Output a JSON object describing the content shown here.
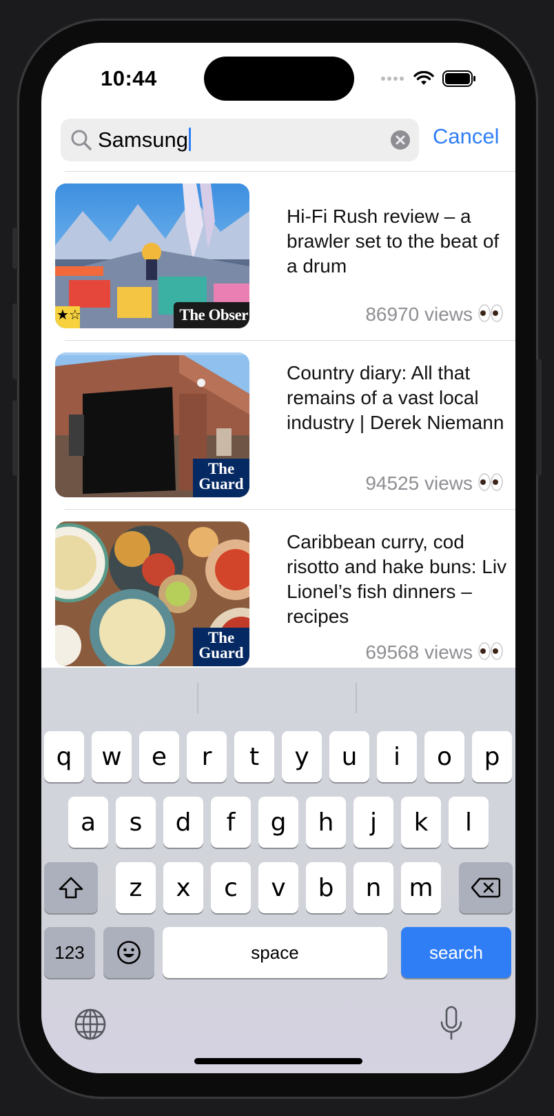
{
  "status": {
    "time": "10:44"
  },
  "search": {
    "query": "Samsung",
    "cancel_label": "Cancel"
  },
  "results": [
    {
      "title": "Hi-Fi Rush review – a brawler set to the beat of a drum",
      "views": "86970 views",
      "source": "The Observer",
      "source_short": "The Obser",
      "rating": "★☆"
    },
    {
      "title": "Country diary: All that remains of a vast local industry | Derek Niemann",
      "views": "94525 views",
      "source": "The Guardian",
      "source_short": "The Guard"
    },
    {
      "title": "Caribbean curry, cod risotto and hake buns: Liv Lionel’s fish dinners – recipes",
      "views": "69568 views",
      "source": "The Guardian",
      "source_short": "The Guard"
    }
  ],
  "keyboard": {
    "row1": [
      "q",
      "w",
      "e",
      "r",
      "t",
      "y",
      "u",
      "i",
      "o",
      "p"
    ],
    "row2": [
      "a",
      "s",
      "d",
      "f",
      "g",
      "h",
      "j",
      "k",
      "l"
    ],
    "row3": [
      "z",
      "x",
      "c",
      "v",
      "b",
      "n",
      "m"
    ],
    "numbers_label": "123",
    "space_label": "space",
    "search_label": "search"
  }
}
